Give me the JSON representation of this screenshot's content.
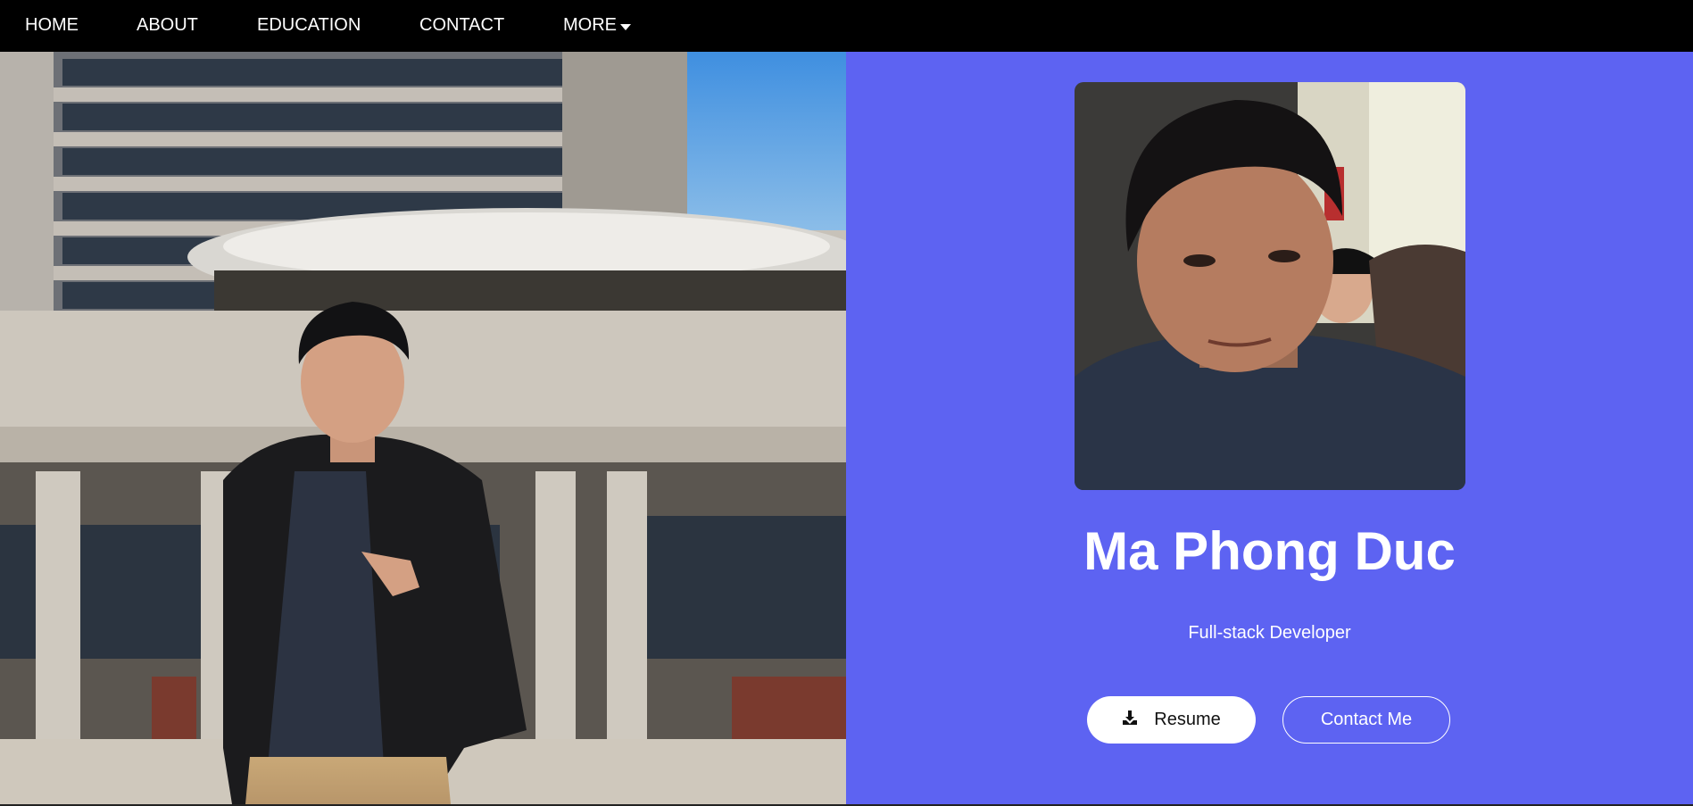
{
  "nav": {
    "items": [
      {
        "label": "HOME"
      },
      {
        "label": "ABOUT"
      },
      {
        "label": "EDUCATION"
      },
      {
        "label": "CONTACT"
      },
      {
        "label": "MORE"
      }
    ]
  },
  "hero": {
    "name": "Ma Phong Duc",
    "role": "Full-stack Developer",
    "resume_label": "Resume",
    "contact_label": "Contact Me"
  },
  "colors": {
    "nav_bg": "#000000",
    "accent_panel": "#5d63f2",
    "text": "#ffffff"
  },
  "icons": {
    "more_caret": "caret-down-icon",
    "resume": "download-icon"
  }
}
